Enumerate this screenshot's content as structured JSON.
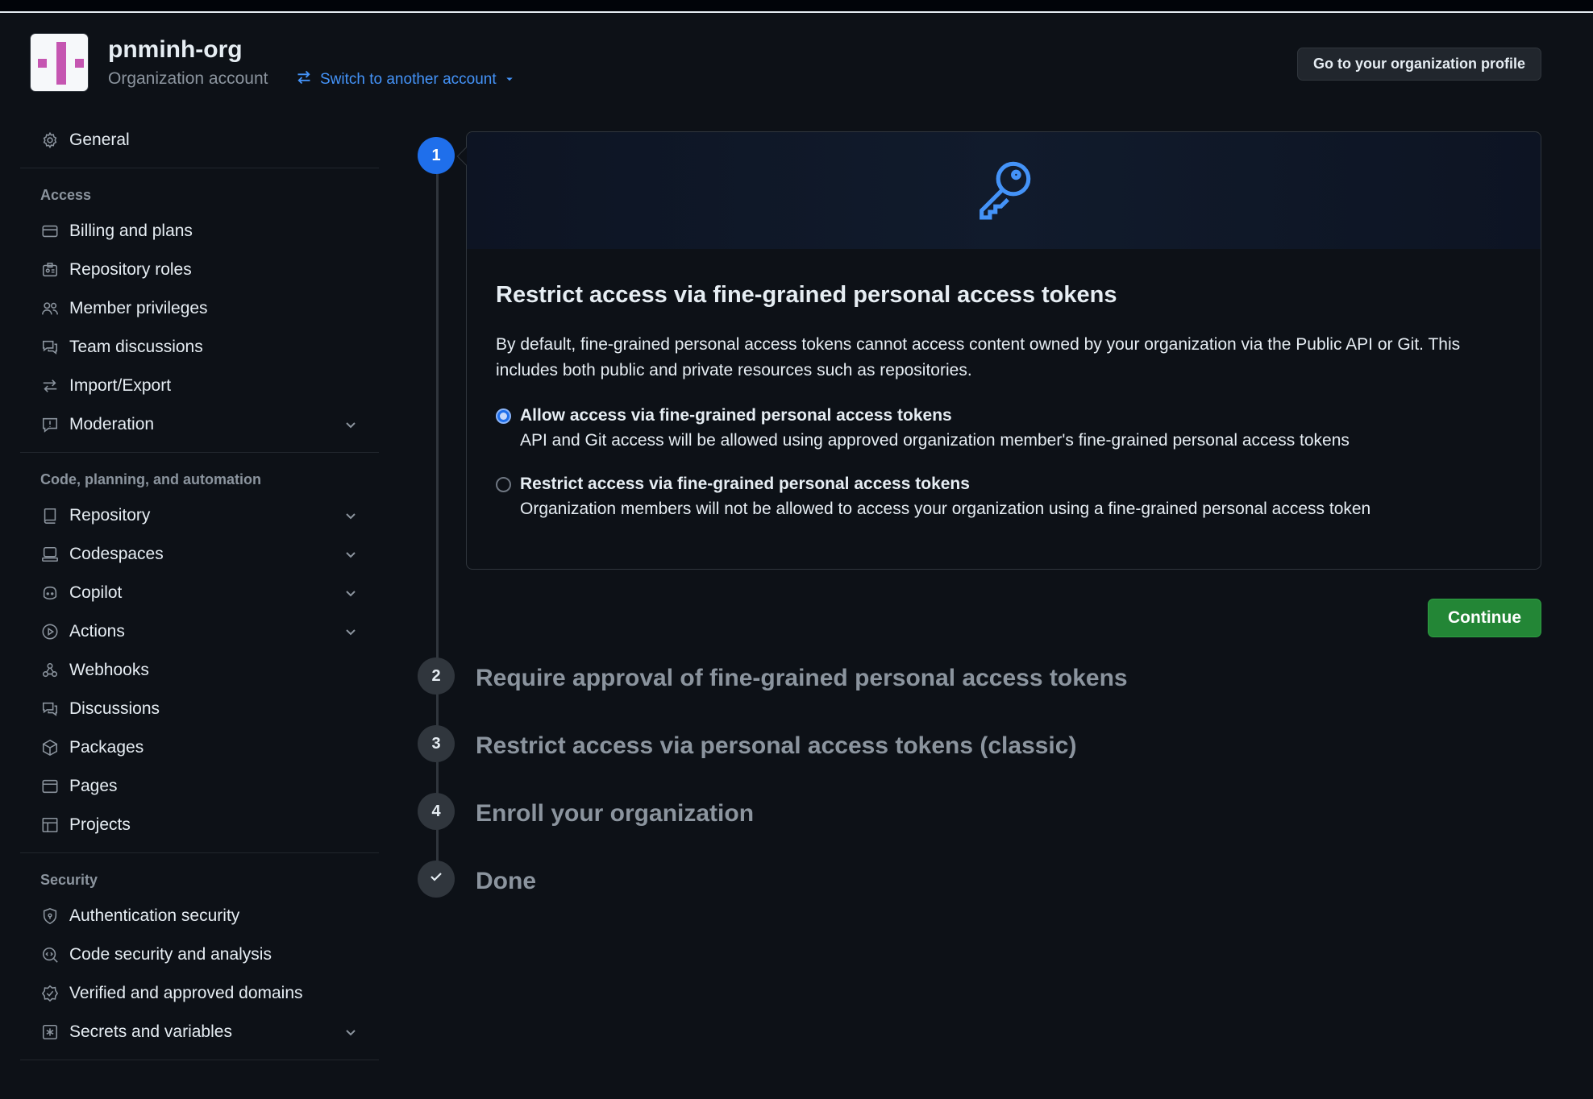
{
  "header": {
    "org_name": "pnminh-org",
    "org_type": "Organization account",
    "switch_label": "Switch to another account",
    "profile_button": "Go to your organization profile"
  },
  "sidebar": {
    "general": "General",
    "groups": [
      {
        "label": "Access",
        "items": [
          {
            "label": "Billing and plans",
            "icon": "credit-card-icon",
            "expandable": false
          },
          {
            "label": "Repository roles",
            "icon": "id-badge-icon",
            "expandable": false
          },
          {
            "label": "Member privileges",
            "icon": "people-icon",
            "expandable": false
          },
          {
            "label": "Team discussions",
            "icon": "comment-discussion-icon",
            "expandable": false
          },
          {
            "label": "Import/Export",
            "icon": "arrow-switch-icon",
            "expandable": false
          },
          {
            "label": "Moderation",
            "icon": "report-icon",
            "expandable": true
          }
        ]
      },
      {
        "label": "Code, planning, and automation",
        "items": [
          {
            "label": "Repository",
            "icon": "repo-icon",
            "expandable": true
          },
          {
            "label": "Codespaces",
            "icon": "codespaces-icon",
            "expandable": true
          },
          {
            "label": "Copilot",
            "icon": "copilot-icon",
            "expandable": true
          },
          {
            "label": "Actions",
            "icon": "play-icon",
            "expandable": true
          },
          {
            "label": "Webhooks",
            "icon": "webhook-icon",
            "expandable": false
          },
          {
            "label": "Discussions",
            "icon": "comment-discussion-icon",
            "expandable": false
          },
          {
            "label": "Packages",
            "icon": "package-icon",
            "expandable": false
          },
          {
            "label": "Pages",
            "icon": "browser-icon",
            "expandable": false
          },
          {
            "label": "Projects",
            "icon": "table-icon",
            "expandable": false
          }
        ]
      },
      {
        "label": "Security",
        "items": [
          {
            "label": "Authentication security",
            "icon": "shield-lock-icon",
            "expandable": false
          },
          {
            "label": "Code security and analysis",
            "icon": "codescan-icon",
            "expandable": false
          },
          {
            "label": "Verified and approved domains",
            "icon": "verified-icon",
            "expandable": false
          },
          {
            "label": "Secrets and variables",
            "icon": "asterisk-icon",
            "expandable": true
          }
        ]
      }
    ]
  },
  "main": {
    "active_step": "1",
    "card_title": "Restrict access via fine-grained personal access tokens",
    "card_description": "By default, fine-grained personal access tokens cannot access content owned by your organization via the Public API or Git. This includes both public and private resources such as repositories.",
    "options": [
      {
        "label": "Allow access via fine-grained personal access tokens",
        "help": "API and Git access will be allowed using approved organization member's fine-grained personal access tokens",
        "checked": true
      },
      {
        "label": "Restrict access via fine-grained personal access tokens",
        "help": "Organization members will not be allowed to access your organization using a fine-grained personal access token",
        "checked": false
      }
    ],
    "continue_label": "Continue",
    "steps": [
      {
        "number": "2",
        "title": "Require approval of fine-grained personal access tokens"
      },
      {
        "number": "3",
        "title": "Restrict access via personal access tokens (classic)"
      },
      {
        "number": "4",
        "title": "Enroll your organization"
      },
      {
        "number": "",
        "title": "Done",
        "icon": "check-icon"
      }
    ]
  },
  "colors": {
    "accent": "#1f6feb",
    "link": "#4493f8",
    "success": "#238636",
    "background": "#0d1117"
  }
}
